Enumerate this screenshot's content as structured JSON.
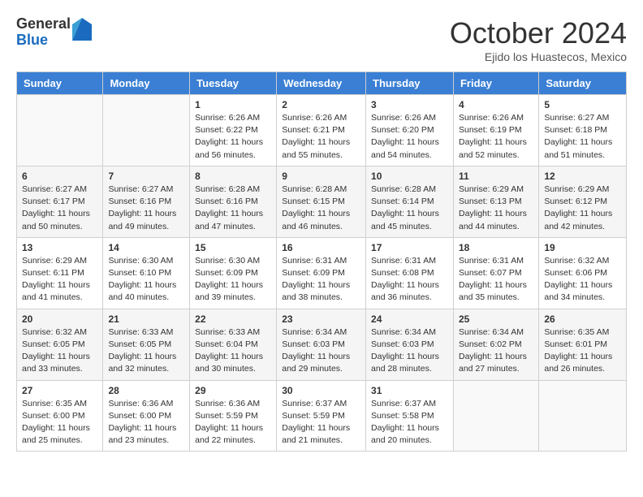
{
  "header": {
    "logo_general": "General",
    "logo_blue": "Blue",
    "month_title": "October 2024",
    "subtitle": "Ejido los Huastecos, Mexico"
  },
  "days_of_week": [
    "Sunday",
    "Monday",
    "Tuesday",
    "Wednesday",
    "Thursday",
    "Friday",
    "Saturday"
  ],
  "weeks": [
    [
      {
        "day": "",
        "info": ""
      },
      {
        "day": "",
        "info": ""
      },
      {
        "day": "1",
        "info": "Sunrise: 6:26 AM\nSunset: 6:22 PM\nDaylight: 11 hours and 56 minutes."
      },
      {
        "day": "2",
        "info": "Sunrise: 6:26 AM\nSunset: 6:21 PM\nDaylight: 11 hours and 55 minutes."
      },
      {
        "day": "3",
        "info": "Sunrise: 6:26 AM\nSunset: 6:20 PM\nDaylight: 11 hours and 54 minutes."
      },
      {
        "day": "4",
        "info": "Sunrise: 6:26 AM\nSunset: 6:19 PM\nDaylight: 11 hours and 52 minutes."
      },
      {
        "day": "5",
        "info": "Sunrise: 6:27 AM\nSunset: 6:18 PM\nDaylight: 11 hours and 51 minutes."
      }
    ],
    [
      {
        "day": "6",
        "info": "Sunrise: 6:27 AM\nSunset: 6:17 PM\nDaylight: 11 hours and 50 minutes."
      },
      {
        "day": "7",
        "info": "Sunrise: 6:27 AM\nSunset: 6:16 PM\nDaylight: 11 hours and 49 minutes."
      },
      {
        "day": "8",
        "info": "Sunrise: 6:28 AM\nSunset: 6:16 PM\nDaylight: 11 hours and 47 minutes."
      },
      {
        "day": "9",
        "info": "Sunrise: 6:28 AM\nSunset: 6:15 PM\nDaylight: 11 hours and 46 minutes."
      },
      {
        "day": "10",
        "info": "Sunrise: 6:28 AM\nSunset: 6:14 PM\nDaylight: 11 hours and 45 minutes."
      },
      {
        "day": "11",
        "info": "Sunrise: 6:29 AM\nSunset: 6:13 PM\nDaylight: 11 hours and 44 minutes."
      },
      {
        "day": "12",
        "info": "Sunrise: 6:29 AM\nSunset: 6:12 PM\nDaylight: 11 hours and 42 minutes."
      }
    ],
    [
      {
        "day": "13",
        "info": "Sunrise: 6:29 AM\nSunset: 6:11 PM\nDaylight: 11 hours and 41 minutes."
      },
      {
        "day": "14",
        "info": "Sunrise: 6:30 AM\nSunset: 6:10 PM\nDaylight: 11 hours and 40 minutes."
      },
      {
        "day": "15",
        "info": "Sunrise: 6:30 AM\nSunset: 6:09 PM\nDaylight: 11 hours and 39 minutes."
      },
      {
        "day": "16",
        "info": "Sunrise: 6:31 AM\nSunset: 6:09 PM\nDaylight: 11 hours and 38 minutes."
      },
      {
        "day": "17",
        "info": "Sunrise: 6:31 AM\nSunset: 6:08 PM\nDaylight: 11 hours and 36 minutes."
      },
      {
        "day": "18",
        "info": "Sunrise: 6:31 AM\nSunset: 6:07 PM\nDaylight: 11 hours and 35 minutes."
      },
      {
        "day": "19",
        "info": "Sunrise: 6:32 AM\nSunset: 6:06 PM\nDaylight: 11 hours and 34 minutes."
      }
    ],
    [
      {
        "day": "20",
        "info": "Sunrise: 6:32 AM\nSunset: 6:05 PM\nDaylight: 11 hours and 33 minutes."
      },
      {
        "day": "21",
        "info": "Sunrise: 6:33 AM\nSunset: 6:05 PM\nDaylight: 11 hours and 32 minutes."
      },
      {
        "day": "22",
        "info": "Sunrise: 6:33 AM\nSunset: 6:04 PM\nDaylight: 11 hours and 30 minutes."
      },
      {
        "day": "23",
        "info": "Sunrise: 6:34 AM\nSunset: 6:03 PM\nDaylight: 11 hours and 29 minutes."
      },
      {
        "day": "24",
        "info": "Sunrise: 6:34 AM\nSunset: 6:03 PM\nDaylight: 11 hours and 28 minutes."
      },
      {
        "day": "25",
        "info": "Sunrise: 6:34 AM\nSunset: 6:02 PM\nDaylight: 11 hours and 27 minutes."
      },
      {
        "day": "26",
        "info": "Sunrise: 6:35 AM\nSunset: 6:01 PM\nDaylight: 11 hours and 26 minutes."
      }
    ],
    [
      {
        "day": "27",
        "info": "Sunrise: 6:35 AM\nSunset: 6:00 PM\nDaylight: 11 hours and 25 minutes."
      },
      {
        "day": "28",
        "info": "Sunrise: 6:36 AM\nSunset: 6:00 PM\nDaylight: 11 hours and 23 minutes."
      },
      {
        "day": "29",
        "info": "Sunrise: 6:36 AM\nSunset: 5:59 PM\nDaylight: 11 hours and 22 minutes."
      },
      {
        "day": "30",
        "info": "Sunrise: 6:37 AM\nSunset: 5:59 PM\nDaylight: 11 hours and 21 minutes."
      },
      {
        "day": "31",
        "info": "Sunrise: 6:37 AM\nSunset: 5:58 PM\nDaylight: 11 hours and 20 minutes."
      },
      {
        "day": "",
        "info": ""
      },
      {
        "day": "",
        "info": ""
      }
    ]
  ]
}
